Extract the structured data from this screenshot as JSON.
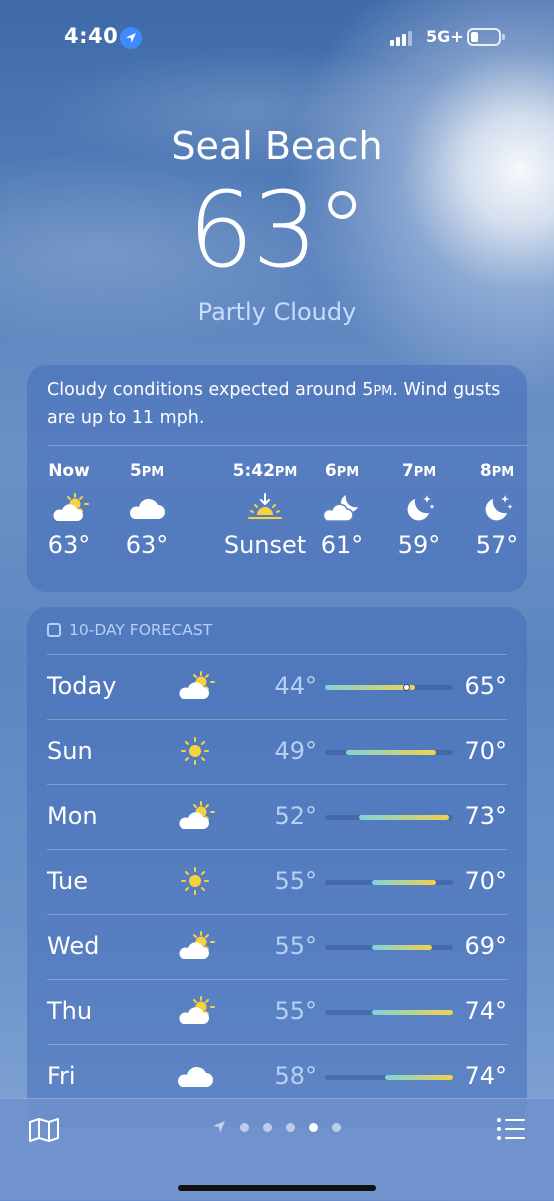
{
  "status_bar": {
    "time": "4:40",
    "network": "5G+"
  },
  "location": {
    "city": "Seal Beach",
    "temperature": "63°",
    "condition": "Partly Cloudy"
  },
  "hourly": {
    "summary_pre": "Cloudy conditions expected around 5",
    "summary_pm": "PM",
    "summary_post": ". Wind gusts are up to 11 mph.",
    "items": [
      {
        "time": "Now",
        "suffix": "",
        "icon": "partly-cloudy-day-icon",
        "value": "63°"
      },
      {
        "time": "5",
        "suffix": "PM",
        "icon": "cloud-icon",
        "value": "63°"
      },
      {
        "time": "5:42",
        "suffix": "PM",
        "icon": "sunset-icon",
        "value": "Sunset"
      },
      {
        "time": "6",
        "suffix": "PM",
        "icon": "partly-cloudy-night-icon",
        "value": "61°"
      },
      {
        "time": "7",
        "suffix": "PM",
        "icon": "moon-stars-icon",
        "value": "59°"
      },
      {
        "time": "8",
        "suffix": "PM",
        "icon": "moon-stars-icon",
        "value": "57°"
      }
    ]
  },
  "forecast": {
    "title": "10-DAY FORECAST",
    "range_min": 44,
    "range_max": 74,
    "days": [
      {
        "day": "Today",
        "icon": "partly-cloudy-day-icon",
        "low": "44°",
        "high": "65°",
        "low_val": 44,
        "high_val": 65,
        "current": 63
      },
      {
        "day": "Sun",
        "icon": "sun-icon",
        "low": "49°",
        "high": "70°",
        "low_val": 49,
        "high_val": 70
      },
      {
        "day": "Mon",
        "icon": "partly-cloudy-day-icon",
        "low": "52°",
        "high": "73°",
        "low_val": 52,
        "high_val": 73
      },
      {
        "day": "Tue",
        "icon": "sun-icon",
        "low": "55°",
        "high": "70°",
        "low_val": 55,
        "high_val": 70
      },
      {
        "day": "Wed",
        "icon": "partly-cloudy-day-icon",
        "low": "55°",
        "high": "69°",
        "low_val": 55,
        "high_val": 69
      },
      {
        "day": "Thu",
        "icon": "partly-cloudy-day-icon",
        "low": "55°",
        "high": "74°",
        "low_val": 55,
        "high_val": 74
      },
      {
        "day": "Fri",
        "icon": "cloud-icon",
        "low": "58°",
        "high": "74°",
        "low_val": 58,
        "high_val": 74
      }
    ]
  },
  "pager": {
    "pages": 5,
    "active_index": 3
  },
  "colors": {
    "bar_cool": "#7fd4d8",
    "bar_warm": "#f2d24a"
  }
}
